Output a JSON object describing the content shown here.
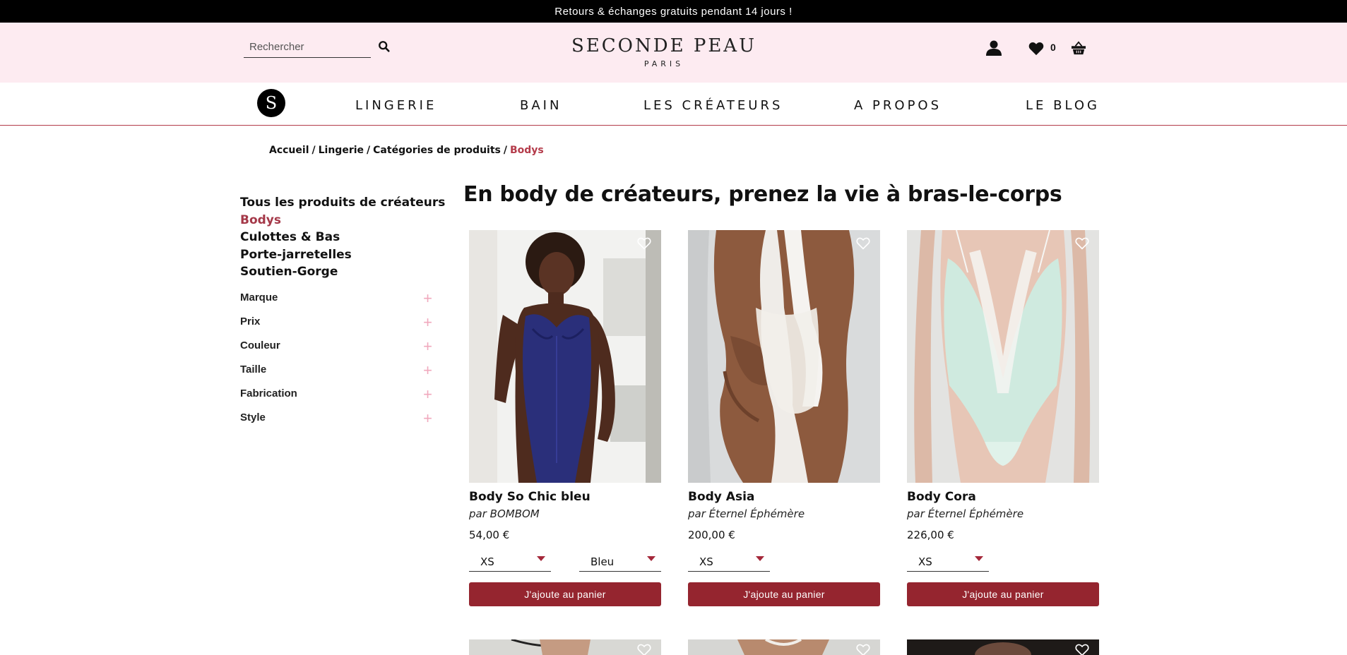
{
  "promo": "Retours & échanges gratuits pendant 14 jours !",
  "header": {
    "search_placeholder": "Rechercher",
    "logo_line1": "SECONDE PEAU",
    "logo_line2": "PARIS",
    "wishlist_count": "0"
  },
  "nav": {
    "logo_letter": "S",
    "items": [
      "LINGERIE",
      "BAIN",
      "LES CRÉATEURS",
      "A PROPOS",
      "LE BLOG"
    ]
  },
  "breadcrumb": {
    "items": [
      "Accueil",
      "Lingerie",
      "Catégories de produits"
    ],
    "current": "Bodys"
  },
  "sidebar": {
    "categories": [
      "Tous les produits de créateurs",
      "Bodys",
      "Culottes & Bas",
      "Porte-jarretelles",
      "Soutien-Gorge"
    ],
    "active_category": "Bodys",
    "filters": [
      "Marque",
      "Prix",
      "Couleur",
      "Taille",
      "Fabrication",
      "Style"
    ]
  },
  "main": {
    "title": "En body de créateurs, prenez la vie à bras-le-corps",
    "products": [
      {
        "name": "Body So Chic bleu",
        "brand": "par BOMBOM",
        "price": "54,00 €",
        "size": "XS",
        "color": "Bleu",
        "button": "J'ajoute au panier"
      },
      {
        "name": "Body Asia",
        "brand": "par Éternel Éphémère",
        "price": "200,00 €",
        "size": "XS",
        "button": "J'ajoute au panier"
      },
      {
        "name": "Body Cora",
        "brand": "par Éternel Éphémère",
        "price": "226,00 €",
        "size": "XS",
        "button": "J'ajoute au panier"
      }
    ]
  },
  "colors": {
    "accent": "#95252f",
    "header_bg": "#fdebf1",
    "active_text": "#a43848"
  }
}
